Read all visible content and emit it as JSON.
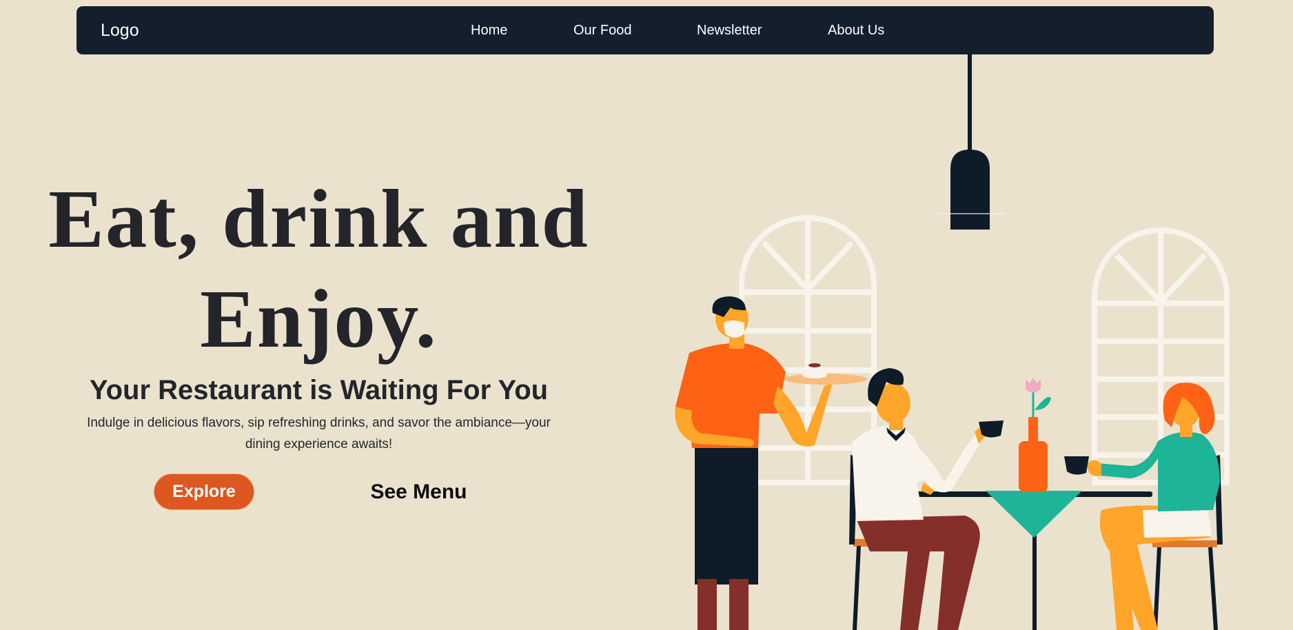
{
  "nav": {
    "logo": "Logo",
    "links": [
      "Home",
      "Our Food",
      "Newsletter",
      "About Us"
    ]
  },
  "hero": {
    "title_line1": "Eat, drink and",
    "title_line2": "Enjoy.",
    "subtitle": "Your Restaurant is Waiting For You",
    "description": "Indulge in delicious flavors, sip refreshing drinks, and savor the ambiance—your dining experience awaits!",
    "explore_label": "Explore",
    "menu_label": "See Menu"
  },
  "colors": {
    "background": "#ebe2ce",
    "nav": "#141f2e",
    "accent": "#df5720",
    "text": "#23252a"
  },
  "illustration": {
    "subject": "restaurant-scene",
    "elements": [
      "pendant-lamp",
      "arched-window",
      "waiter",
      "diner-man",
      "diner-woman",
      "table",
      "vase-flower"
    ]
  }
}
